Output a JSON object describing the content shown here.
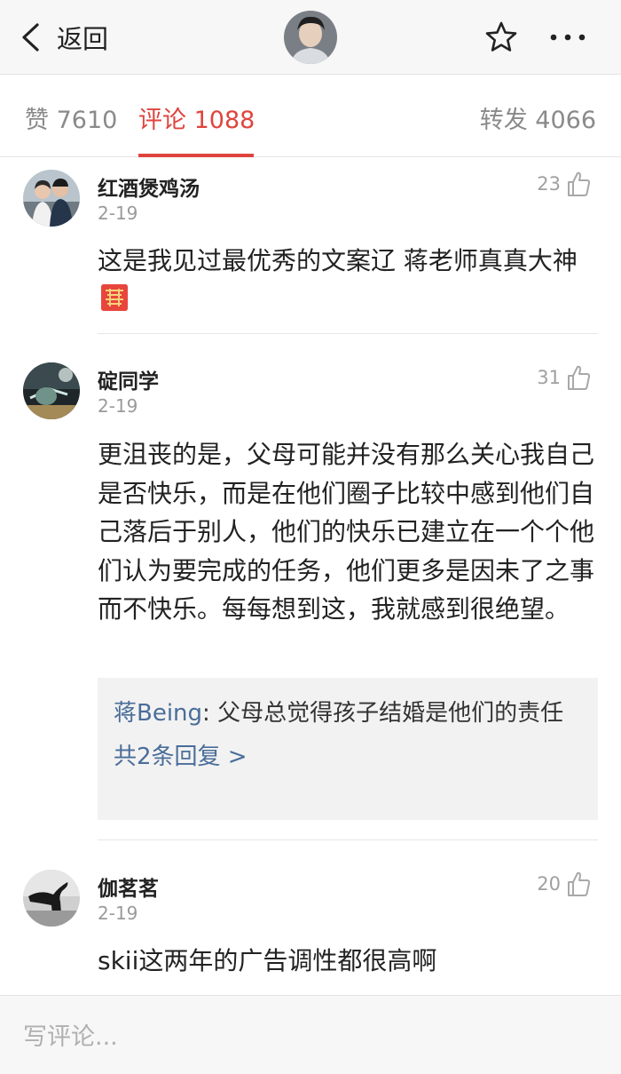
{
  "nav": {
    "back_label": "返回"
  },
  "tabs": {
    "like": "赞 7610",
    "comments": "评论 1088",
    "reposts": "转发 4066"
  },
  "comments": [
    {
      "name": "红酒煲鸡汤",
      "date": "2-19",
      "likes": "23",
      "text": "这是我见过最优秀的文案辽 蒋老师真真大神"
    },
    {
      "name": "碇同学",
      "date": "2-19",
      "likes": "31",
      "text": "更沮丧的是，父母可能并没有那么关心我自己是否快乐，而是在他们圈子比较中感到他们自己落后于别人，他们的快乐已建立在一个个他们认为要完成的任务，他们更多是因未了之事而不快乐。每每想到这，我就感到很绝望。",
      "reply": {
        "author": "蒋Being",
        "separator": ": ",
        "text": "父母总觉得孩子结婚是他们的责任",
        "more": "共2条回复 >"
      }
    },
    {
      "name": "伽茗茗",
      "date": "2-19",
      "likes": "20",
      "text": "skii这两年的广告调性都很高啊"
    }
  ],
  "input": {
    "placeholder": "写评论..."
  },
  "colors": {
    "accent": "#e0443e",
    "link": "#4a6d99",
    "muted": "#9a9a9a"
  },
  "icons": [
    "back-arrow-icon",
    "star-icon",
    "more-icon",
    "thumbs-up-icon",
    "double-happiness-emoji"
  ]
}
